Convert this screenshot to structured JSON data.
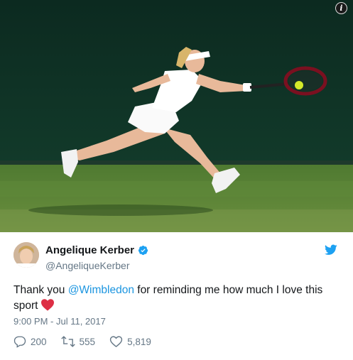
{
  "tweet": {
    "author_name": "Angelique Kerber",
    "author_handle": "@AngeliqueKerber",
    "text_before": "Thank you ",
    "mention": "@Wimbledon",
    "text_after": " for reminding me how much I love this sport",
    "emoji": "heart-emoji",
    "timestamp": "9:00 PM - Jul 11, 2017",
    "reply_count": "200",
    "retweet_count": "555",
    "like_count": "5,819"
  },
  "icons": {
    "verified": "verified-badge-icon",
    "brand": "twitter-bird-icon",
    "info": "info-icon",
    "reply": "reply-icon",
    "retweet": "retweet-icon",
    "like": "like-icon"
  },
  "colors": {
    "twitter_blue": "#1da1f2",
    "mention_blue": "#1b95e0",
    "text": "#14171a",
    "muted": "#657786",
    "heart": "#e0245e"
  }
}
